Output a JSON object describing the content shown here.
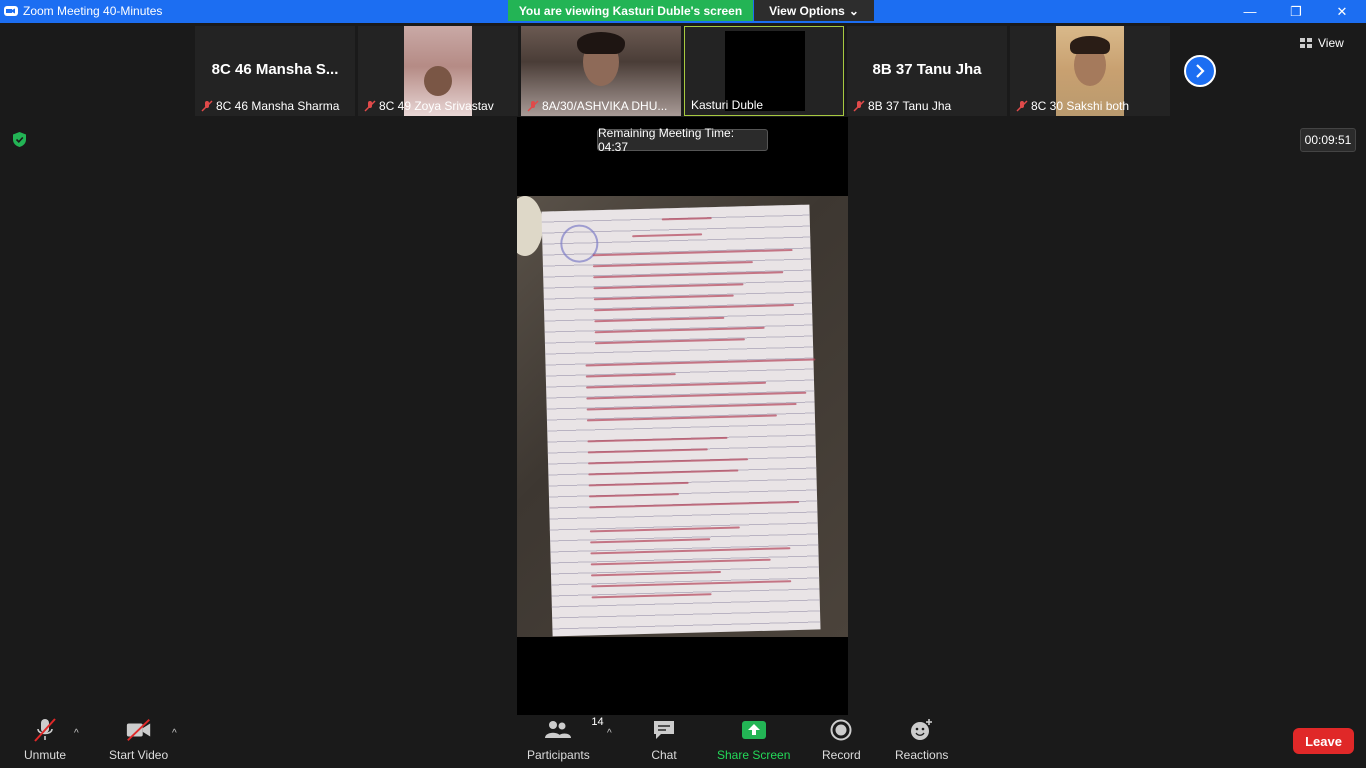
{
  "window": {
    "title": "Zoom Meeting 40-Minutes"
  },
  "banner": {
    "text": "You are viewing Kasturi Duble's screen",
    "view_options": "View Options"
  },
  "participants": [
    {
      "big_name": "8C 46 Mansha S...",
      "label": "8C 46 Mansha Sharma",
      "video": false
    },
    {
      "big_name": "",
      "label": "8C 49 Zoya Srivastav",
      "video": true
    },
    {
      "big_name": "",
      "label": "8A/30/ASHVIKA DHU...",
      "video": true
    },
    {
      "big_name": "",
      "label": "Kasturi Duble",
      "video": true
    },
    {
      "big_name": "8B 37 Tanu Jha",
      "label": "8B 37 Tanu Jha",
      "video": false
    },
    {
      "big_name": "",
      "label": "8C 30 Sakshi both",
      "video": true
    }
  ],
  "view_label": "View",
  "elapsed_time": "00:09:51",
  "remaining_time": "Remaining Meeting Time: 04:37",
  "toolbar": {
    "unmute": "Unmute",
    "start_video": "Start Video",
    "participants": "Participants",
    "participants_count": "14",
    "chat": "Chat",
    "share_screen": "Share Screen",
    "record": "Record",
    "reactions": "Reactions",
    "leave": "Leave"
  },
  "colors": {
    "title_bar": "#1c6ef2",
    "banner": "#23b455",
    "share_screen": "#23d959",
    "leave": "#e02828"
  }
}
